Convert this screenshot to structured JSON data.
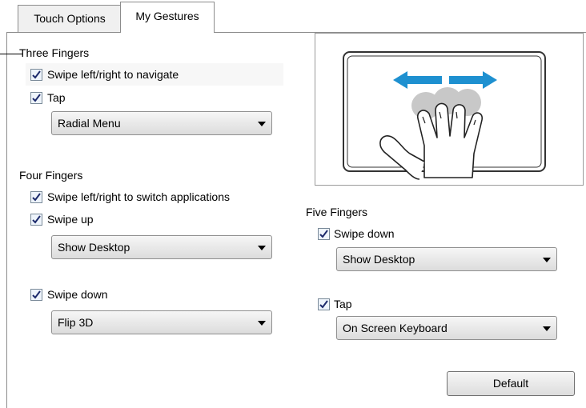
{
  "tabs": [
    {
      "label": "Touch Options"
    },
    {
      "label": "My Gestures"
    }
  ],
  "three_fingers": {
    "heading": "Three Fingers",
    "swipe_label": "Swipe left/right to navigate",
    "swipe_checked": true,
    "tap_label": "Tap",
    "tap_checked": true,
    "tap_select": "Radial Menu"
  },
  "four_fingers": {
    "heading": "Four Fingers",
    "swipe_label": "Swipe left/right to switch applications",
    "swipe_checked": true,
    "swipe_up_label": "Swipe up",
    "swipe_up_checked": true,
    "swipe_up_select": "Show Desktop",
    "swipe_down_label": "Swipe down",
    "swipe_down_checked": true,
    "swipe_down_select": "Flip 3D"
  },
  "five_fingers": {
    "heading": "Five Fingers",
    "swipe_down_label": "Swipe down",
    "swipe_down_checked": true,
    "swipe_down_select": "Show Desktop",
    "tap_label": "Tap",
    "tap_checked": true,
    "tap_select": "On Screen Keyboard"
  },
  "default_button": "Default",
  "colors": {
    "arrow": "#1e90d0",
    "finger_shadow": "#c8c8c8"
  }
}
